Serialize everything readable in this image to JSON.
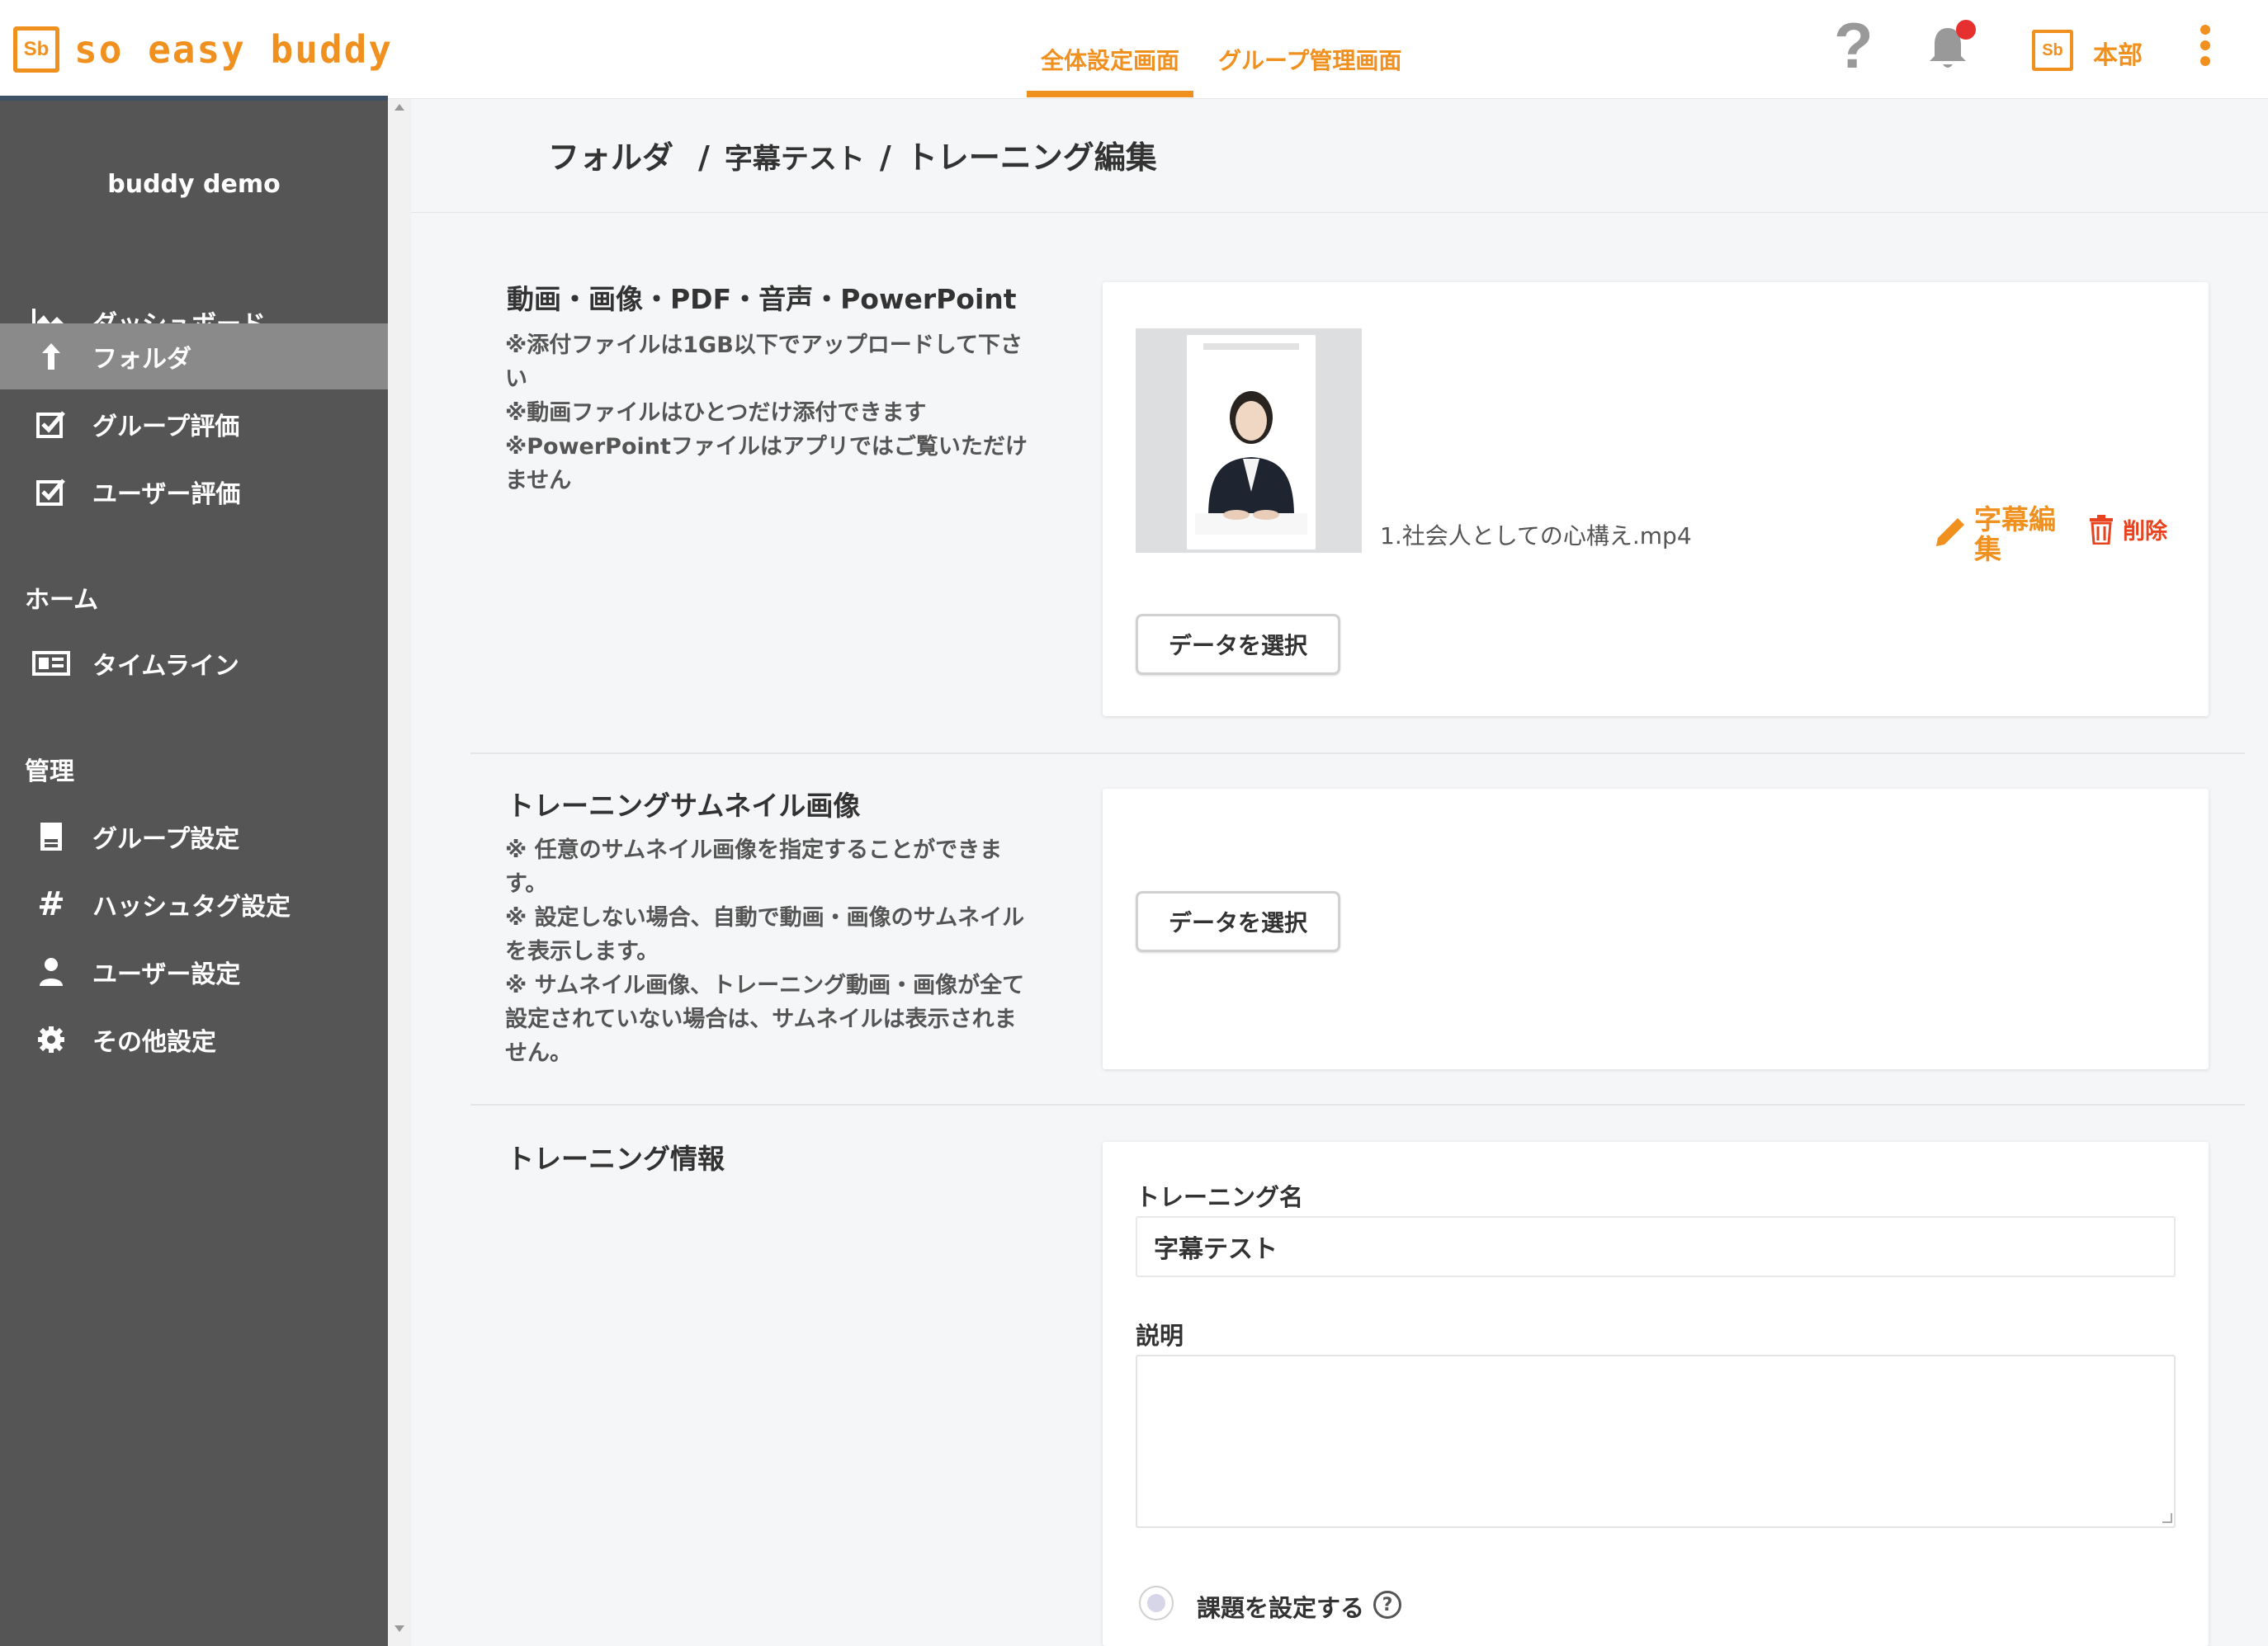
{
  "header": {
    "logo_mark": "Sb",
    "logo_text": "so easy buddy",
    "tabs": [
      {
        "label": "全体設定画面",
        "active": true
      },
      {
        "label": "グループ管理画面",
        "active": false
      }
    ],
    "help_glyph": "?",
    "user_mark": "Sb",
    "user_name": "本部",
    "accent_color": "#f0901e"
  },
  "sidebar": {
    "company_name": "buddy demo",
    "items": [
      {
        "label": "ダッシュボード",
        "icon": "chart-icon"
      },
      {
        "label": "フォルダ",
        "icon": "upload-arrow-icon",
        "active": true
      },
      {
        "label": "グループ評価",
        "icon": "checkbox-icon"
      },
      {
        "label": "ユーザー評価",
        "icon": "checkbox-icon"
      }
    ],
    "section_home": "ホーム",
    "home_items": [
      {
        "label": "タイムライン",
        "icon": "timeline-icon"
      }
    ],
    "section_admin": "管理",
    "admin_items": [
      {
        "label": "グループ設定",
        "icon": "document-icon"
      },
      {
        "label": "ハッシュタグ設定",
        "icon": "hash-icon"
      },
      {
        "label": "ユーザー設定",
        "icon": "user-icon"
      },
      {
        "label": "その他設定",
        "icon": "gear-icon"
      }
    ]
  },
  "breadcrumb": {
    "items": [
      "フォルダ",
      "字幕テスト",
      "トレーニング編集"
    ],
    "separator": "/"
  },
  "media_section": {
    "title": "動画・画像・PDF・音声・PowerPoint",
    "notes": [
      "※添付ファイルは1GB以下でアップロードして下さい",
      "※動画ファイルはひとつだけ添付できます",
      "※PowerPointファイルはアプリではご覧いただけません"
    ],
    "file_name": "1.社会人としての心構え.mp4",
    "edit_subtitle_label": "字幕編集",
    "delete_label": "削除",
    "select_button": "データを選択"
  },
  "thumbnail_section": {
    "title": "トレーニングサムネイル画像",
    "notes": [
      "※ 任意のサムネイル画像を指定することができます。",
      "※ 設定しない場合、自動で動画・画像のサムネイルを表示します。",
      "※ サムネイル画像、トレーニング動画・画像が全て設定されていない場合は、サムネイルは表示されません。"
    ],
    "select_button": "データを選択"
  },
  "info_section": {
    "title": "トレーニング情報",
    "name_label": "トレーニング名",
    "name_value": "字幕テスト",
    "description_label": "説明",
    "description_value": "",
    "task_label": "課題を設定する",
    "task_help": "?"
  }
}
